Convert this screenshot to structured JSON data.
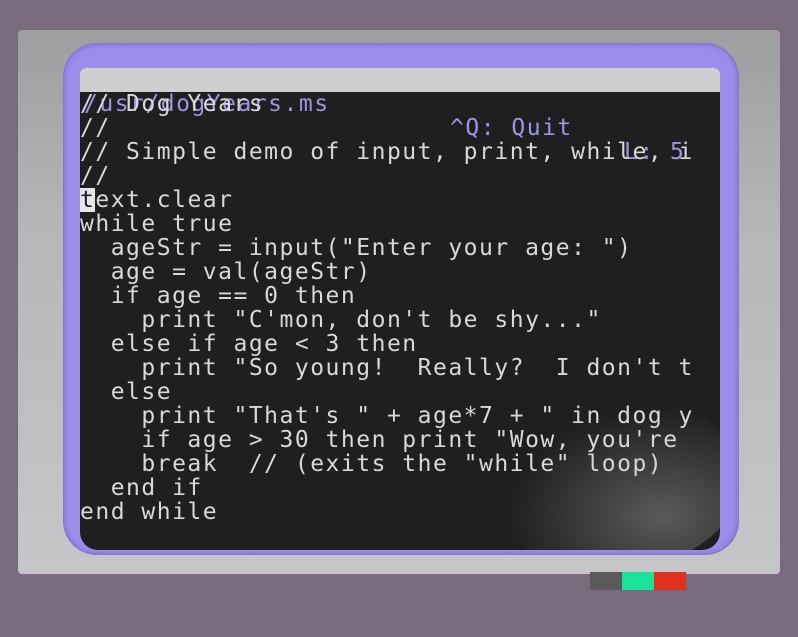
{
  "editor": {
    "file_path": "/usr/dogYears.ms",
    "quit_hint": "^Q: Quit",
    "line_indicator": "L: 5"
  },
  "code_lines": [
    "// Dog Years",
    "//",
    "// Simple demo of input, print, while, i",
    "//",
    "text.clear",
    "while true",
    "  ageStr = input(\"Enter your age: \")",
    "  age = val(ageStr)",
    "  if age == 0 then",
    "    print \"C'mon, don't be shy...\"",
    "  else if age < 3 then",
    "    print \"So young!  Really?  I don't t",
    "  else",
    "    print \"That's \" + age*7 + \" in dog y",
    "    if age > 30 then print \"Wow, you're",
    "    break  // (exits the \"while\" loop)",
    "  end if",
    "end while"
  ],
  "cursor_line": 5,
  "colors": {
    "background": "#7a6a7d",
    "screen_frame": "#9a8eea",
    "screen": "#1f1f1f",
    "text": "#d8d8d8",
    "header_bg": "#cfcfcf",
    "header_text": "#9b95e6",
    "led_grey": "#5a5a5a",
    "led_green": "#19e39a",
    "led_red": "#e0311f"
  },
  "status_leds": [
    "grey",
    "green",
    "red"
  ]
}
